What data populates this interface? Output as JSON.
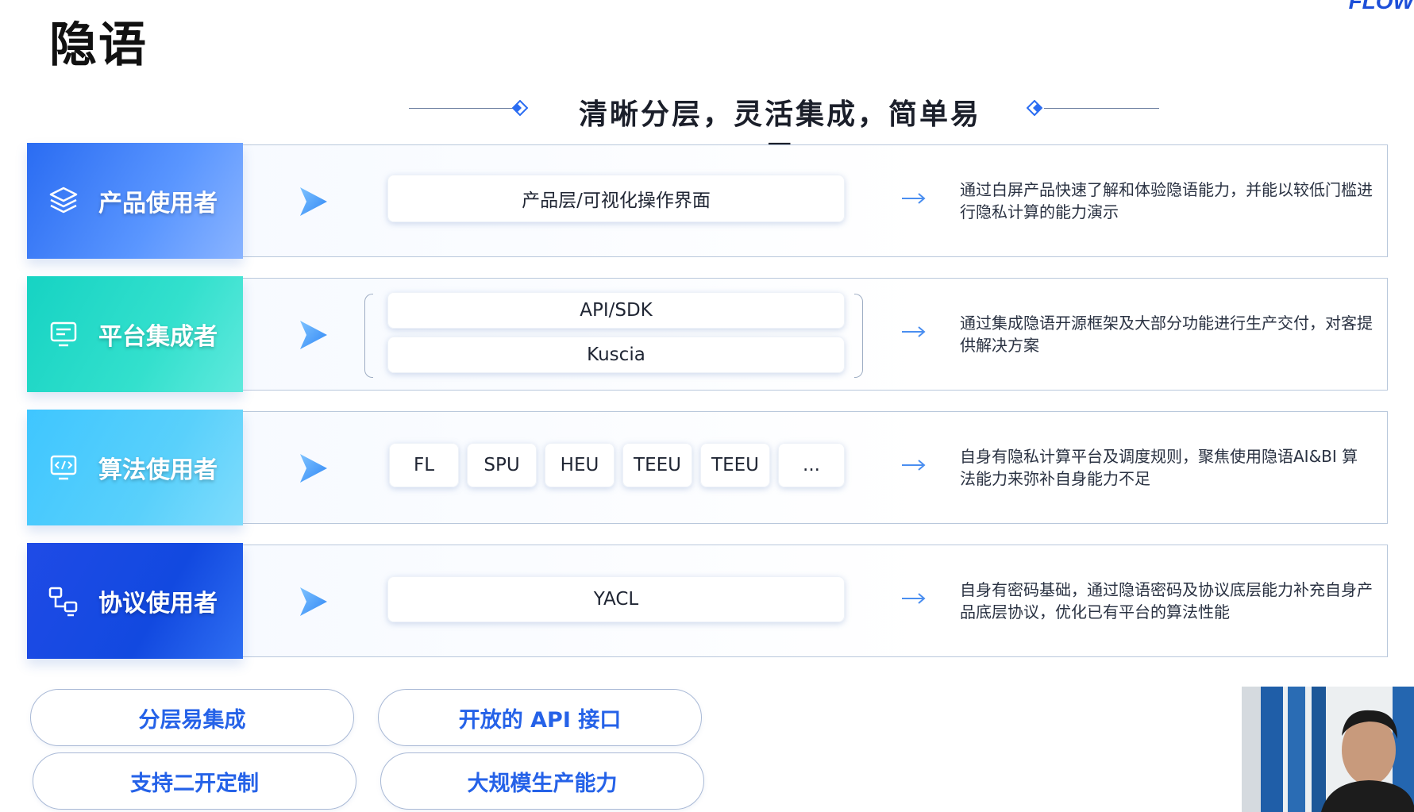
{
  "header": {
    "title": "隐语",
    "logo": "FLOW",
    "subtitle": "清晰分层，灵活集成，简单易用"
  },
  "rows": [
    {
      "role": "产品使用者",
      "icon": "layers-icon",
      "components": [
        "产品层/可视化操作界面"
      ],
      "description": "通过白屏产品快速了解和体验隐语能力，并能以较低门槛进行隐私计算的能力演示"
    },
    {
      "role": "平台集成者",
      "icon": "monitor-icon",
      "components": [
        "API/SDK",
        "Kuscia"
      ],
      "description": "通过集成隐语开源框架及大部分功能进行生产交付，对客提供解决方案"
    },
    {
      "role": "算法使用者",
      "icon": "code-screen-icon",
      "components": [
        "FL",
        "SPU",
        "HEU",
        "TEEU",
        "TEEU",
        "..."
      ],
      "description": "自身有隐私计算平台及调度规则，聚焦使用隐语AI&BI 算法能力来弥补自身能力不足"
    },
    {
      "role": "协议使用者",
      "icon": "network-icon",
      "components": [
        "YACL"
      ],
      "description": "自身有密码基础，通过隐语密码及协议底层能力补充自身产品底层协议，优化已有平台的算法性能"
    }
  ],
  "features": [
    "分层易集成",
    "开放的 API 接口",
    "支持二开定制",
    "大规模生产能力"
  ],
  "colors": {
    "role1": "#2a6cf2",
    "role2": "#16d3c3",
    "role3": "#3fc6ff",
    "role4": "#1f4be6",
    "accent": "#2562e8"
  }
}
